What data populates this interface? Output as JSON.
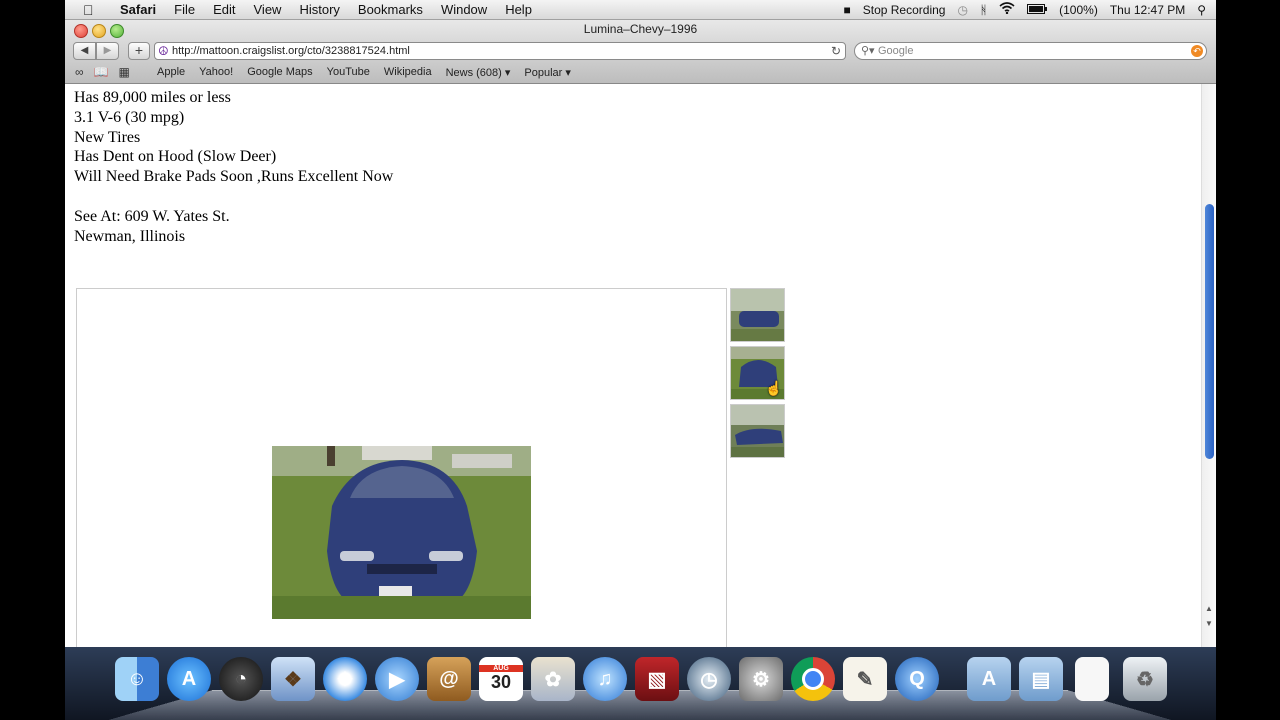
{
  "menubar": {
    "app": "Safari",
    "items": [
      "File",
      "Edit",
      "View",
      "History",
      "Bookmarks",
      "Window",
      "Help"
    ],
    "status": {
      "recording": "Stop Recording",
      "battery": "(100%)",
      "clock": "Thu 12:47 PM"
    }
  },
  "window": {
    "title": "Lumina–Chevy–1996"
  },
  "toolbar": {
    "url": "http://mattoon.craigslist.org/cto/3238817524.html",
    "search_placeholder": "Google"
  },
  "bookmarks": [
    "Apple",
    "Yahoo!",
    "Google Maps",
    "YouTube",
    "Wikipedia",
    "News (608) ▾",
    "Popular ▾"
  ],
  "listing": {
    "lines": [
      "Has 89,000 miles or less",
      "3.1 V-6 (30 mpg)",
      "New Tires",
      "Has Dent on Hood (Slow Deer)",
      "Will Need Brake Pads Soon ,Runs Excellent Now",
      "",
      "See At: 609 W. Yates St.",
      "Newman, Illinois"
    ]
  },
  "colors": {
    "scroll_thumb": "#2a62c5",
    "car_blue": "#2f3f7a",
    "grass": "#6d8a3a"
  },
  "dock": {
    "icons": [
      "finder-icon",
      "app-store-icon",
      "dashboard-icon",
      "mail-icon",
      "safari-icon",
      "facetime-icon",
      "address-book-icon",
      "calendar-icon",
      "iphoto-icon",
      "itunes-icon",
      "photo-booth-icon",
      "time-machine-icon",
      "system-preferences-icon",
      "chrome-icon",
      "textedit-icon",
      "quicktime-icon",
      "applications-folder-icon",
      "documents-folder-icon",
      "file-icon",
      "trash-icon"
    ],
    "calendar_day": "30",
    "calendar_month": "AUG"
  }
}
